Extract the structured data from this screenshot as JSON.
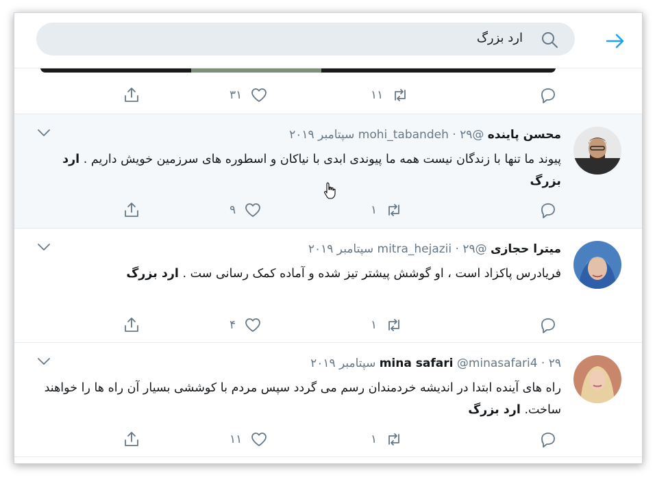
{
  "search": {
    "query": "ارد بزرگ"
  },
  "top_tweet": {
    "retweets": "۱۱",
    "likes": "۳۱"
  },
  "tweets": [
    {
      "name": "محسن پاینده",
      "handle": "@mohi_tabandeh",
      "dot": "·",
      "date": "۲۹ سپتامبر ۲۰۱۹",
      "text": "پیوند ما تنها با زندگان نیست همه ما پیوندی ابدی با نیاکان و اسطوره های سرزمین خویش داریم .",
      "hashtag": "ارد بزرگ",
      "replies": "",
      "retweets": "۱",
      "likes": "۹"
    },
    {
      "name": "میترا حجازی",
      "handle": "@mitra_hejazii",
      "dot": "·",
      "date": "۲۹ سپتامبر ۲۰۱۹",
      "text": "فریادرس پاکزاد است ، او گوشش پیشتر تیز شده و آماده کمک رسانی ست .",
      "hashtag": "ارد بزرگ",
      "replies": "",
      "retweets": "۱",
      "likes": "۴"
    },
    {
      "name": "mina safari",
      "handle": "@minasafari4",
      "dot": "·",
      "date": "۲۹ سپتامبر ۲۰۱۹",
      "text": "راه های آینده ابتدا در اندیشه خردمندان رسم می گردد سپس مردم با کوششی بسیار آن راه ها را خواهند ساخت.",
      "hashtag": "ارد بزرگ",
      "replies": "",
      "retweets": "۱",
      "likes": "۱۱"
    }
  ],
  "colors": {
    "accent": "#1da1f2",
    "muted": "#657786",
    "text": "#14171a",
    "highlight": "#f5f8fa"
  }
}
